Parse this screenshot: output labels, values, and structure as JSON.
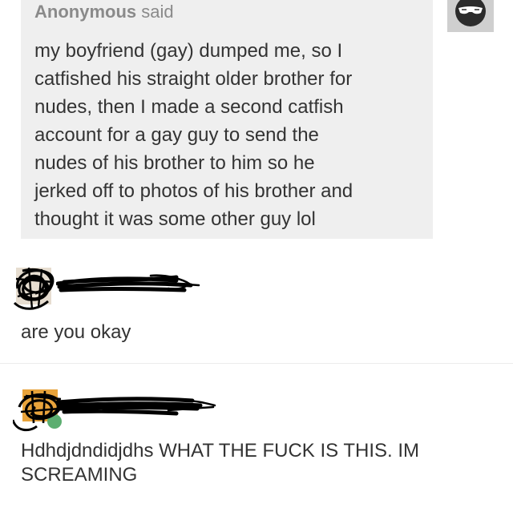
{
  "ask": {
    "asker": "Anonymous",
    "verb": "said",
    "lines": [
      "my boyfriend (gay) dumped me, so I",
      "catfished his straight older brother for",
      "nudes, then I made a second catfish",
      "account for a gay guy to send the",
      "nudes of his brother to him so he",
      "jerked off to photos of his brother and",
      "thought it was some other guy lol"
    ],
    "avatar_icon": "sunglasses-face-icon"
  },
  "replies": [
    {
      "text_lines": [
        "are you okay"
      ],
      "avatar_icon": "scribbled-avatar-icon",
      "username_redacted": true
    },
    {
      "text_lines": [
        "Hdhdjdndidjdhs WHAT THE FUCK IS THIS. IM",
        "SCREAMING"
      ],
      "avatar_icon": "scribbled-avatar-icon",
      "username_redacted": true
    }
  ],
  "colors": {
    "card_bg": "#efefef",
    "header_text": "#8a8a8a",
    "body_text": "#333333",
    "redaction": "#000000"
  }
}
